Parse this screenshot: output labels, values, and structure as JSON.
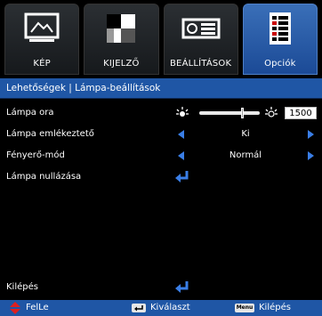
{
  "tabs": [
    {
      "label": "KÉP",
      "icon": "picture-icon",
      "active": false
    },
    {
      "label": "KIJELZŐ",
      "icon": "display-icon",
      "active": false
    },
    {
      "label": "BEÁLLÍTÁSOK",
      "icon": "projector-icon",
      "active": false
    },
    {
      "label": "Opciók",
      "icon": "options-icon",
      "active": true
    }
  ],
  "breadcrumb": "Lehetőségek | Lámpa-beállítások",
  "menu": {
    "lamp_hours": {
      "label": "Lámpa ora",
      "value": "1500",
      "level": 0.7
    },
    "lamp_reminder": {
      "label": "Lámpa emlékeztető",
      "value": "Ki"
    },
    "brightness_mode": {
      "label": "Fényerő-mód",
      "value": "Normál"
    },
    "lamp_reset": {
      "label": "Lámpa nullázása"
    },
    "exit": {
      "label": "Kilépés"
    }
  },
  "footer": {
    "updown": "FelLe",
    "select": "Kiválaszt",
    "menu_key": "Menu",
    "exit": "Kilépés"
  },
  "colors": {
    "accent": "#1f56a5",
    "active_tab": "#2a5fb0",
    "arrow": "#3a7ee6"
  }
}
